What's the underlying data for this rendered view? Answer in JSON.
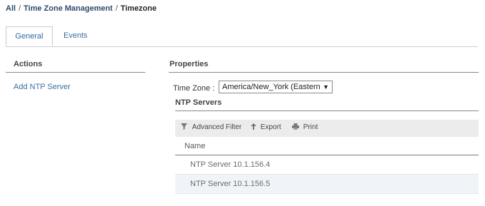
{
  "breadcrumb": {
    "root": "All",
    "middle": "Time Zone Management",
    "current": "Timezone",
    "separator": "/"
  },
  "tabs": [
    {
      "label": "General",
      "active": true
    },
    {
      "label": "Events",
      "active": false
    }
  ],
  "actions": {
    "title": "Actions",
    "items": [
      "Add NTP Server"
    ]
  },
  "properties": {
    "title": "Properties",
    "timezone_label": "Time Zone :",
    "timezone_value": "America/New_York (Eastern",
    "ntp_title": "NTP Servers",
    "toolbar": {
      "filter": "Advanced Filter",
      "export": "Export",
      "print": "Print"
    },
    "table": {
      "columns": [
        "Name"
      ],
      "rows": [
        "NTP Server 10.1.156.4",
        "NTP Server 10.1.156.5"
      ]
    }
  },
  "colors": {
    "link": "#3a6ea5",
    "toolbar_bg": "#ececec",
    "row_highlight": "#f0f4f8"
  }
}
